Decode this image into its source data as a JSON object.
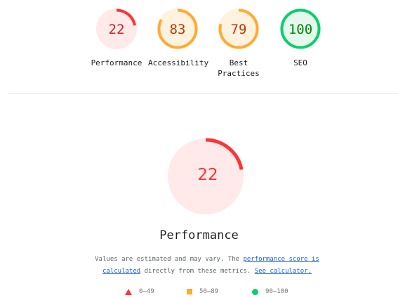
{
  "colors": {
    "fail": "#ff3333",
    "fail_bg": "#ffe9e9",
    "fail_text": "#c7221f",
    "average": "#ffaa33",
    "average_bg": "#fff3e0",
    "average_text": "#c33300",
    "pass": "#0cce6b",
    "pass_bg": "#e6f8ee",
    "pass_text": "#008800",
    "link": "#1a5fd6"
  },
  "gauges": [
    {
      "score": 22,
      "label": "Performance",
      "rating": "fail"
    },
    {
      "score": 83,
      "label": "Accessibility",
      "rating": "average"
    },
    {
      "score": 79,
      "label": "Best Practices",
      "rating": "average"
    },
    {
      "score": 100,
      "label": "SEO",
      "rating": "pass"
    }
  ],
  "main": {
    "score": 22,
    "title": "Performance",
    "rating": "fail",
    "desc_prefix": "Values are estimated and may vary. The ",
    "desc_link1": "performance score is calculated",
    "desc_middle": " directly from these metrics. ",
    "desc_link2": "See calculator."
  },
  "legend": [
    {
      "icon": "triangle",
      "range": "0–49"
    },
    {
      "icon": "square",
      "range": "50–89"
    },
    {
      "icon": "circle",
      "range": "90–100"
    }
  ]
}
